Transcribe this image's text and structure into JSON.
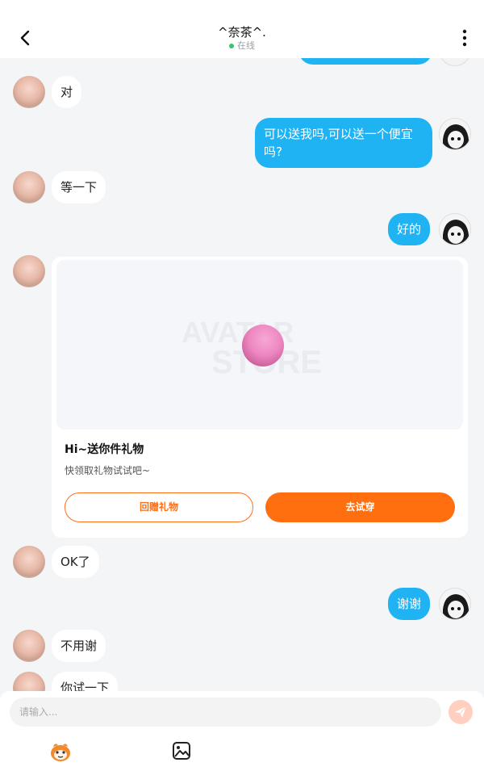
{
  "header": {
    "title": "^奈茶^.",
    "status": "在线"
  },
  "messages": [
    {
      "side": "left",
      "text": "对"
    },
    {
      "side": "right",
      "text": "可以送我吗,可以送一个便宜吗?"
    },
    {
      "side": "left",
      "text": "等一下"
    },
    {
      "side": "right",
      "text": "好的"
    },
    {
      "side": "left",
      "text": "OK了"
    },
    {
      "side": "right",
      "text": "谢谢"
    },
    {
      "side": "left",
      "text": "不用谢"
    },
    {
      "side": "left",
      "text": "你试一下"
    }
  ],
  "gift_card": {
    "watermark_line1": "AVATAR",
    "watermark_line2": "STORE",
    "title": "Hi~送你件礼物",
    "subtitle": "快领取礼物试试吧~",
    "return_gift_label": "回赠礼物",
    "try_on_label": "去试穿"
  },
  "input": {
    "placeholder": "请输入..."
  },
  "colors": {
    "accent_blue": "#1fb3f4",
    "accent_orange": "#ff6f10",
    "online_green": "#2ec76b"
  },
  "icons": [
    "back-icon",
    "more-icon",
    "send-icon",
    "sticker-icon",
    "image-icon"
  ]
}
